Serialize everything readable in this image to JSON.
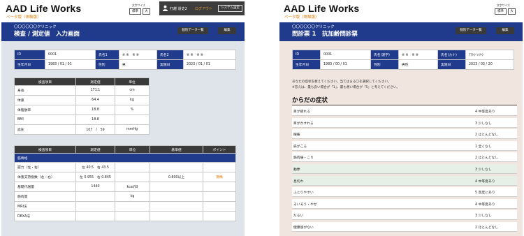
{
  "header": {
    "brand": "AAD Life Works",
    "brand_sub": "ベータ版（体験版）",
    "text_size_label": "文字サイズ",
    "size_std": "標準",
    "size_large": "大",
    "user_name": "打越 道史2",
    "logout": "ログアウト",
    "system_settings": "システム設定"
  },
  "nav": {
    "data_list": "個別データ一覧",
    "edit": "編集"
  },
  "left": {
    "clinic": "〇〇〇〇〇〇クリニック",
    "title": "検査 / 測定値　入力画面",
    "info": {
      "id_label": "ID",
      "id_value": "0001",
      "name1_label": "氏名1",
      "name1_value": "※ ※　※ ※",
      "name2_label": "氏名2",
      "name2_value": "※ ※　※ ※",
      "dob_label": "生年月日",
      "dob_value": "1983 / 01 / 01",
      "sex_label": "性別",
      "sex_value": "男",
      "date_label": "実施日",
      "date_value": "2023 / 01 / 01"
    },
    "measure_headers": [
      "検査項目",
      "測定値",
      "単位"
    ],
    "measures": [
      {
        "item": "身長",
        "value": "171.1",
        "unit": "cm"
      },
      {
        "item": "体重",
        "value": "64.4",
        "unit": "kg"
      },
      {
        "item": "体脂肪率",
        "value": "18.8",
        "unit": "%"
      },
      {
        "item": "BMI",
        "value": "18.8",
        "unit": ""
      },
      {
        "item": "血圧",
        "value": "107　/　59",
        "unit": "mmHg"
      }
    ],
    "muscle_headers": [
      "検査項目",
      "測定値",
      "単位",
      "基準値",
      "ポイント"
    ],
    "muscle_category": "筋骨格",
    "muscle_rows": [
      {
        "item": "握力（左・右）",
        "value": "左 40.5　右 43.5",
        "unit": "",
        "ref": "",
        "point": ""
      },
      {
        "item": "体重支持指数（左・右）",
        "value": "左 0.955　右 0.845",
        "unit": "",
        "ref": "0.800以上",
        "point": "要精"
      },
      {
        "item": "基礎代謝量",
        "value": "1440",
        "unit": "kcal/日",
        "ref": "",
        "point": ""
      },
      {
        "item": "筋肉量",
        "value": "",
        "unit": "kg",
        "ref": "",
        "point": ""
      },
      {
        "item": "MRI法",
        "value": "",
        "unit": "",
        "ref": "",
        "point": ""
      },
      {
        "item": "DEXA法",
        "value": "",
        "unit": "",
        "ref": "",
        "point": ""
      }
    ]
  },
  "right": {
    "clinic": "〇〇〇〇〇〇クリニック",
    "title": "問診票 1　抗加齢問診票",
    "info": {
      "id_label": "ID",
      "id_value": "0001",
      "name1_label": "氏名(漢字)",
      "name1_value": "※ ※　※ ※",
      "name2_label": "氏名(カナ)",
      "name2_value": "ｱｱｹｳ ｿﾒｹｳ",
      "dob_label": "生年月日",
      "dob_value": "1983 / 00 / 01",
      "sex_label": "性別",
      "sex_value": "男性",
      "date_label": "実施日",
      "date_value": "2023 / 03 / 20"
    },
    "intro1": "あなたの症状を教えてください。当てはまる〇を選択してください。",
    "intro2": "※答えは、最も良い場合が「1」、最も悪い場合が「5」と考えてください。",
    "section_title": "からだの症状",
    "questions": [
      {
        "q": "目が疲れる",
        "a": "4 中等度あり",
        "hl": false
      },
      {
        "q": "目がかすれる",
        "a": "3 少しなし",
        "hl": false
      },
      {
        "q": "眼痛",
        "a": "2 ほとんどなし",
        "hl": false
      },
      {
        "q": "肩がこる",
        "a": "1 全くなし",
        "hl": false
      },
      {
        "q": "筋肉痛・こり",
        "a": "2 ほとんどなし",
        "hl": false
      },
      {
        "q": "動悸",
        "a": "3 少しなし",
        "hl": true
      },
      {
        "q": "息切れ",
        "a": "4 中等度あり",
        "hl": true
      },
      {
        "q": "ふとりやすい",
        "a": "5 高度にあり",
        "hl": false
      },
      {
        "q": "るいそう・やせ",
        "a": "4 中等度あり",
        "hl": false
      },
      {
        "q": "だるい",
        "a": "3 少しなし",
        "hl": false
      },
      {
        "q": "健康感がない",
        "a": "2 ほとんどなし",
        "hl": false
      }
    ],
    "highlight_color": "#e6f0e6"
  }
}
